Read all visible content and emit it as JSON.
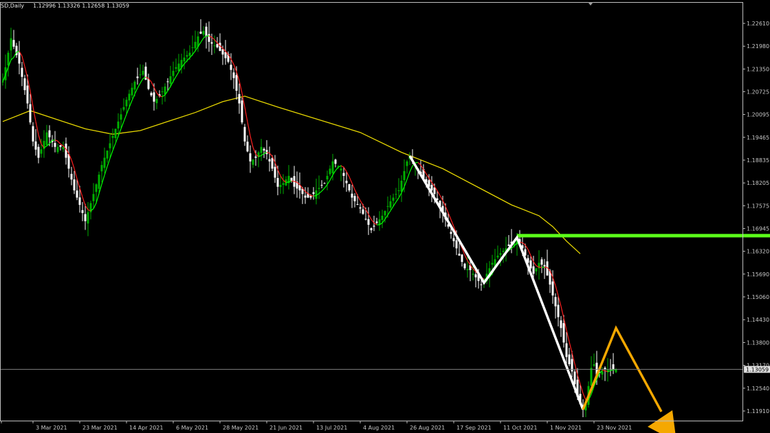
{
  "header": {
    "symbol_period": "SD,Daily",
    "ohlc": "1.12996 1.13326 1.12658 1.13059"
  },
  "colors": {
    "background": "#000000",
    "frame": "#c0c0c0",
    "bull_candle": "#00b000",
    "bear_candle": "#ffffff",
    "fast_ma_up": "#00ff00",
    "fast_ma_down": "#ff2020",
    "slow_ma": "#e8d800",
    "resistance_line": "#5cff1a",
    "pattern_line": "#ffffff",
    "projection": "#f5a800",
    "current_price_line": "#808080"
  },
  "chart_data": {
    "type": "candlestick",
    "instrument_timeframe": "SD,Daily",
    "last_price": "1.13059",
    "ylim": [
      1.116,
      1.23
    ],
    "y_ticks": [
      "1.22610",
      "1.21980",
      "1.21350",
      "1.20725",
      "1.20095",
      "1.19465",
      "1.18835",
      "1.18205",
      "1.17575",
      "1.16945",
      "1.16320",
      "1.15690",
      "1.15060",
      "1.14430",
      "1.13800",
      "1.13170",
      "1.12540",
      "1.11910"
    ],
    "x_ticks": [
      "3 Mar 2021",
      "23 Mar 2021",
      "14 Apr 2021",
      "6 May 2021",
      "28 May 2021",
      "21 Jun 2021",
      "13 Jul 2021",
      "4 Aug 2021",
      "26 Aug 2021",
      "17 Sep 2021",
      "11 Oct 2021",
      "1 Nov 2021",
      "23 Nov 2021"
    ],
    "x_tick_index": [
      11,
      28,
      45,
      62,
      79,
      96,
      113,
      130,
      147,
      164,
      181,
      198,
      215
    ],
    "bar_count": 224,
    "close_anchors": [
      [
        0,
        1.21
      ],
      [
        3,
        1.222
      ],
      [
        6,
        1.215
      ],
      [
        9,
        1.204
      ],
      [
        11,
        1.1935
      ],
      [
        13,
        1.189
      ],
      [
        16,
        1.196
      ],
      [
        19,
        1.192
      ],
      [
        22,
        1.192
      ],
      [
        24,
        1.186
      ],
      [
        26,
        1.18
      ],
      [
        28,
        1.176
      ],
      [
        30,
        1.1715
      ],
      [
        33,
        1.179
      ],
      [
        36,
        1.187
      ],
      [
        39,
        1.193
      ],
      [
        42,
        1.199
      ],
      [
        45,
        1.205
      ],
      [
        48,
        1.21
      ],
      [
        51,
        1.213
      ],
      [
        53,
        1.208
      ],
      [
        55,
        1.2045
      ],
      [
        57,
        1.206
      ],
      [
        60,
        1.21
      ],
      [
        62,
        1.213
      ],
      [
        65,
        1.216
      ],
      [
        68,
        1.218
      ],
      [
        71,
        1.2225
      ],
      [
        73,
        1.224
      ],
      [
        75,
        1.221
      ],
      [
        78,
        1.2195
      ],
      [
        80,
        1.2175
      ],
      [
        82,
        1.2155
      ],
      [
        84,
        1.211
      ],
      [
        86,
        1.204
      ],
      [
        88,
        1.1935
      ],
      [
        90,
        1.188
      ],
      [
        92,
        1.189
      ],
      [
        94,
        1.192
      ],
      [
        96,
        1.19
      ],
      [
        98,
        1.186
      ],
      [
        100,
        1.181
      ],
      [
        102,
        1.182
      ],
      [
        104,
        1.184
      ],
      [
        106,
        1.181
      ],
      [
        108,
        1.18
      ],
      [
        110,
        1.178
      ],
      [
        112,
        1.178
      ],
      [
        114,
        1.18
      ],
      [
        117,
        1.182
      ],
      [
        120,
        1.188
      ],
      [
        123,
        1.186
      ],
      [
        125,
        1.182
      ],
      [
        127,
        1.178
      ],
      [
        130,
        1.175
      ],
      [
        132,
        1.172
      ],
      [
        134,
        1.169
      ],
      [
        136,
        1.171
      ],
      [
        138,
        1.173
      ],
      [
        141,
        1.177
      ],
      [
        144,
        1.18
      ],
      [
        147,
        1.188
      ],
      [
        148,
        1.1895
      ],
      [
        150,
        1.187
      ],
      [
        152,
        1.1845
      ],
      [
        155,
        1.181
      ],
      [
        157,
        1.179
      ],
      [
        160,
        1.174
      ],
      [
        162,
        1.17
      ],
      [
        164,
        1.166
      ],
      [
        166,
        1.162
      ],
      [
        168,
        1.1585
      ],
      [
        170,
        1.158
      ],
      [
        172,
        1.156
      ],
      [
        174,
        1.154
      ],
      [
        176,
        1.157
      ],
      [
        178,
        1.16
      ],
      [
        180,
        1.162
      ],
      [
        183,
        1.164
      ],
      [
        186,
        1.166
      ],
      [
        187,
        1.167
      ],
      [
        189,
        1.164
      ],
      [
        191,
        1.16
      ],
      [
        193,
        1.157
      ],
      [
        195,
        1.16
      ],
      [
        197,
        1.159
      ],
      [
        199,
        1.154
      ],
      [
        201,
        1.148
      ],
      [
        203,
        1.142
      ],
      [
        205,
        1.134
      ],
      [
        207,
        1.13
      ],
      [
        209,
        1.123
      ],
      [
        210,
        1.121
      ],
      [
        211,
        1.1195
      ],
      [
        212,
        1.121
      ],
      [
        213,
        1.126
      ],
      [
        214,
        1.131
      ],
      [
        215,
        1.132
      ],
      [
        216,
        1.129
      ],
      [
        218,
        1.13
      ],
      [
        219,
        1.1306
      ]
    ],
    "series": [
      {
        "role": "slow moving average",
        "color": "#e8d800",
        "points": [
          [
            0,
            1.199
          ],
          [
            10,
            1.202
          ],
          [
            20,
            1.1995
          ],
          [
            30,
            1.197
          ],
          [
            40,
            1.1955
          ],
          [
            50,
            1.1965
          ],
          [
            60,
            1.199
          ],
          [
            70,
            1.2015
          ],
          [
            80,
            1.2045
          ],
          [
            88,
            1.206
          ],
          [
            100,
            1.203
          ],
          [
            115,
            1.1995
          ],
          [
            130,
            1.196
          ],
          [
            145,
            1.1905
          ],
          [
            160,
            1.186
          ],
          [
            175,
            1.18
          ],
          [
            185,
            1.176
          ],
          [
            195,
            1.173
          ],
          [
            200,
            1.17
          ],
          [
            205,
            1.166
          ],
          [
            210,
            1.1625
          ]
        ]
      }
    ],
    "annotations": {
      "resistance_level": 1.1675,
      "resistance_from_index": 187,
      "pattern_zigzag": [
        [
          148,
          1.1895
        ],
        [
          175,
          1.1545
        ],
        [
          187,
          1.167
        ],
        [
          211,
          1.1195
        ]
      ],
      "projection_path": [
        [
          211,
          1.1195
        ],
        [
          223,
          1.142
        ],
        [
          245,
          1.114
        ]
      ]
    }
  }
}
